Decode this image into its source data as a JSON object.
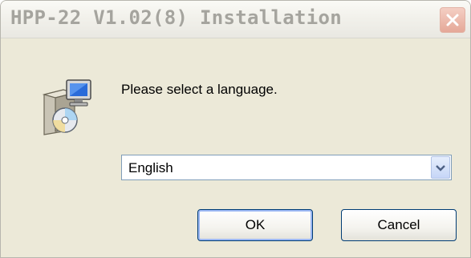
{
  "window": {
    "title": "HPP-22 V1.02(8) Installation",
    "close_icon": "close-icon"
  },
  "dialog": {
    "icon": "setup-installer-icon",
    "prompt": "Please select a language.",
    "language_select": {
      "selected": "English"
    },
    "buttons": {
      "ok_label": "OK",
      "cancel_label": "Cancel"
    }
  },
  "colors": {
    "face": "#ece9d8",
    "button_border": "#003c74",
    "focus_ring": "#9bb7f3",
    "close_button": "#e5a898"
  }
}
